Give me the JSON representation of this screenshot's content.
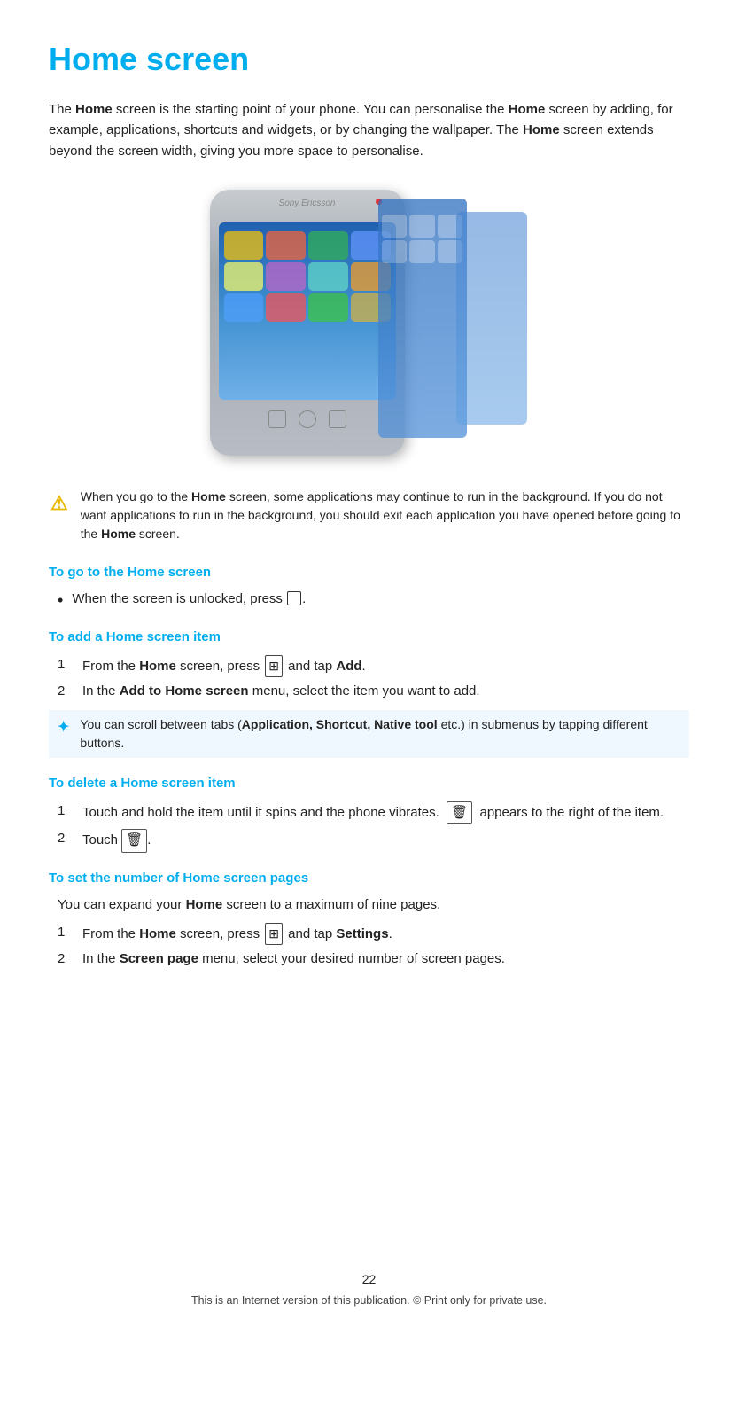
{
  "page": {
    "title": "Home screen",
    "intro": {
      "text_parts": [
        "The ",
        "Home",
        " screen is the starting point of your phone. You can personalise the ",
        "Home",
        " screen by adding, for example, applications, shortcuts and widgets, or by changing the wallpaper. The ",
        "Home",
        " screen extends beyond the screen width, giving you more space to personalise."
      ]
    },
    "warning": {
      "icon": "!",
      "text_before": "When you go to the ",
      "bold1": "Home",
      "text_mid": " screen, some applications may continue to run in the background. If you do not want applications to run in the background, you should exit each application you have opened before going to the ",
      "bold2": "Home",
      "text_after": " screen."
    },
    "sections": [
      {
        "id": "go-to-home",
        "heading": "To go to the Home screen",
        "type": "bullet",
        "items": [
          {
            "text_before": "When the screen is unlocked, press ",
            "icon": "□",
            "text_after": "."
          }
        ]
      },
      {
        "id": "add-home-item",
        "heading": "To add a Home screen item",
        "type": "numbered",
        "items": [
          {
            "num": "1",
            "text_before": "From the ",
            "bold1": "Home",
            "text_mid": " screen, press ",
            "icon": "⊞",
            "text_after_icon": " and tap ",
            "bold2": "Add",
            "text_after": "."
          },
          {
            "num": "2",
            "text_before": "In the ",
            "bold1": "Add to Home screen",
            "text_after": " menu, select the item you want to add."
          }
        ],
        "tip": {
          "icon": "✦",
          "text_before": "You can scroll between tabs (",
          "bold1": "Application, Shortcut, Native tool",
          "text_after": " etc.) in submenus by tapping different buttons."
        }
      },
      {
        "id": "delete-home-item",
        "heading": "To delete a Home screen item",
        "type": "numbered",
        "items": [
          {
            "num": "1",
            "text": "Touch and hold the item until it spins and the phone vibrates.",
            "icon_desc": "trash",
            "text_after": " appears to the right of the item."
          },
          {
            "num": "2",
            "text_before": "Touch ",
            "icon_desc": "trash",
            "text_after": "."
          }
        ]
      },
      {
        "id": "set-pages",
        "heading": "To set the number of Home screen pages",
        "description": {
          "text_before": "You can expand your ",
          "bold": "Home",
          "text_after": " screen to a maximum of nine pages."
        },
        "type": "numbered",
        "items": [
          {
            "num": "1",
            "text_before": "From the ",
            "bold1": "Home",
            "text_mid": " screen, press ",
            "icon": "⊞",
            "text_after_icon": " and tap ",
            "bold2": "Settings",
            "text_after": "."
          },
          {
            "num": "2",
            "text_before": "In the ",
            "bold1": "Screen page",
            "text_after": " menu, select your desired number of screen pages."
          }
        ]
      }
    ],
    "footer": {
      "page_number": "22",
      "footer_text": "This is an Internet version of this publication. © Print only for private use."
    }
  }
}
